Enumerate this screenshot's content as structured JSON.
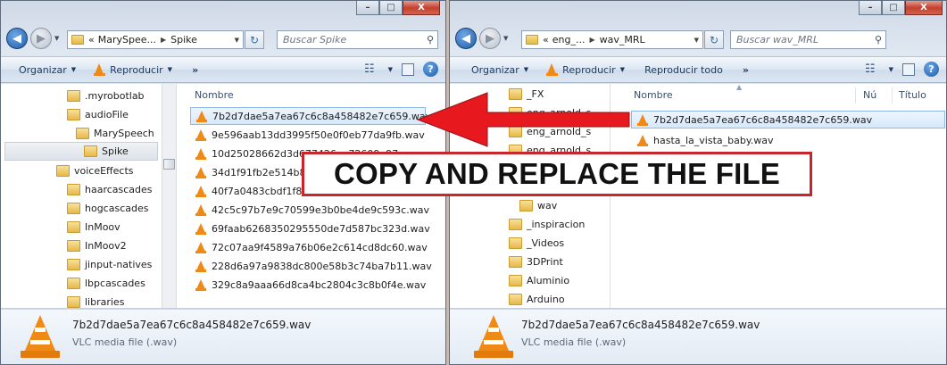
{
  "left": {
    "breadcrumb": [
      "«",
      "MarySpee...",
      "Spike"
    ],
    "search_placeholder": "Buscar Spike",
    "toolbar": {
      "organize": "Organizar",
      "play": "Reproducir",
      "more": "»"
    },
    "tree": [
      {
        "label": ".myrobotlab"
      },
      {
        "label": "audioFile"
      },
      {
        "label": "MarySpeech"
      },
      {
        "label": "Spike"
      },
      {
        "label": "voiceEffects"
      },
      {
        "label": "haarcascades"
      },
      {
        "label": "hogcascades"
      },
      {
        "label": "InMoov"
      },
      {
        "label": "InMoov2"
      },
      {
        "label": "jinput-natives"
      },
      {
        "label": "lbpcascades"
      },
      {
        "label": "libraries"
      }
    ],
    "column_name": "Nombre",
    "files": [
      "7b2d7dae5a7ea67c6c8a458482e7c659.wav",
      "9e596aab13dd3995f50e0f0eb77da9fb.wav",
      "10d25028662d3d677426aa72609a97e.wav",
      "34d1f91fb2e514b85",
      "40f7a0483cbdf1f80",
      "42c5c97b7e9c70599e3b0be4de9c593c.wav",
      "69faab6268350295550de7d587bc323d.wav",
      "72c07aa9f4589a76b06e2c614cd8dc60.wav",
      "228d6a97a9838dc800e58b3c74ba7b11.wav",
      "329c8a9aaa66d8ca4bc2804c3c8b0f4e.wav"
    ],
    "details": {
      "name": "7b2d7dae5a7ea67c6c8a458482e7c659.wav",
      "type": "VLC media file (.wav)"
    }
  },
  "right": {
    "breadcrumb": [
      "«",
      "eng_...",
      "wav_MRL"
    ],
    "search_placeholder": "Buscar wav_MRL",
    "toolbar": {
      "organize": "Organizar",
      "play": "Reproducir",
      "play_all": "Reproducir todo",
      "more": "»"
    },
    "tree": [
      {
        "label": "_FX"
      },
      {
        "label": "eng_arnold_s"
      },
      {
        "label": "eng_arnold_s"
      },
      {
        "label": "eng_arnold_s"
      },
      {
        "label": "wav"
      },
      {
        "label": "_inspiracion"
      },
      {
        "label": "_Videos"
      },
      {
        "label": "3DPrint"
      },
      {
        "label": "Aluminio"
      },
      {
        "label": "Arduino"
      }
    ],
    "columns": {
      "name": "Nombre",
      "number": "Nú",
      "title": "Título"
    },
    "files": [
      "7b2d7dae5a7ea67c6c8a458482e7c659.wav",
      "hasta_la_vista_baby.wav"
    ],
    "details": {
      "name": "7b2d7dae5a7ea67c6c8a458482e7c659.wav",
      "type": "VLC media file (.wav)"
    }
  },
  "caption_buttons": {
    "minimize": "–",
    "maximize": "□",
    "close": "X"
  },
  "icons": {
    "back": "back-arrow-icon",
    "forward": "forward-arrow-icon",
    "refresh": "refresh-icon",
    "search": "search-icon",
    "folder": "folder-icon",
    "vlc": "vlc-cone-icon",
    "help": "help-icon"
  },
  "annotation": {
    "text": "COPY AND REPLACE THE FILE",
    "arrow_color": "#e8191e",
    "box_border_color": "#c8262b"
  },
  "colors": {
    "selection_bg": "#d6e8fb",
    "selection_border": "#8fb9e6",
    "vlc_orange": "#f08a17"
  }
}
